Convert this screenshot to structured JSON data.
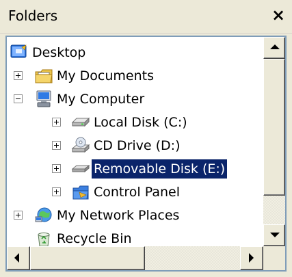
{
  "header": {
    "title": "Folders",
    "close_label": "×"
  },
  "tree": {
    "desktop": {
      "label": "Desktop"
    },
    "my_documents": {
      "label": "My Documents",
      "expander": "+"
    },
    "my_computer": {
      "label": "My Computer",
      "expander": "-"
    },
    "local_disk": {
      "label": "Local Disk (C:)",
      "expander": "+"
    },
    "cd_drive": {
      "label": "CD Drive (D:)",
      "expander": "+"
    },
    "removable_disk": {
      "label": "Removable Disk (E:)",
      "expander": "+",
      "selected": true
    },
    "control_panel": {
      "label": "Control Panel",
      "expander": "+"
    },
    "my_network_places": {
      "label": "My Network Places",
      "expander": "+"
    },
    "recycle_bin": {
      "label": "Recycle Bin"
    }
  },
  "scrollbars": {
    "vertical_position_fraction": 0.0,
    "horizontal_position_fraction": 0.0
  },
  "colors": {
    "selection_bg": "#0a246a",
    "selection_text": "#ffffff",
    "pane_bg": "#ece9d8",
    "tree_bg": "#ffffff"
  }
}
